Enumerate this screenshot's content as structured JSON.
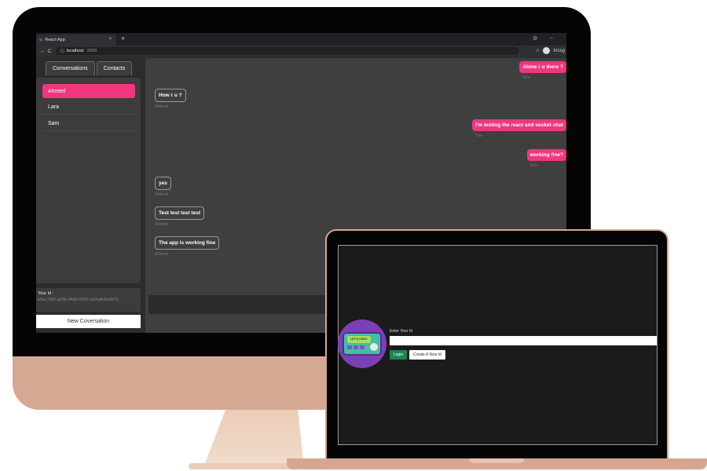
{
  "browser": {
    "tab_title": "React App",
    "tab_close": "×",
    "new_tab": "+",
    "url_host": "localhost",
    "url_port": ":3000",
    "profile_label": "Incog"
  },
  "sidebar": {
    "tabs": [
      {
        "label": "Conversations",
        "active": true
      },
      {
        "label": "Contacts",
        "active": false
      }
    ],
    "conversations": [
      {
        "name": "Ahmed",
        "active": true
      },
      {
        "name": "Lara",
        "active": false
      },
      {
        "name": "Sam",
        "active": false
      }
    ],
    "your_id_label": "Your Id :",
    "your_id_value": "e5ec7d2f-a05b-44d0-9002-e03a4c6e6b71",
    "new_conversation_label": "New Coversation"
  },
  "messages": [
    {
      "text": "Ahme r u there ?",
      "sender": "You",
      "outgoing": true
    },
    {
      "text": "How r u ?",
      "sender": "Ahmed",
      "outgoing": false
    },
    {
      "text": "I'm testing the react and socket chat",
      "sender": "You",
      "outgoing": true
    },
    {
      "text": "working fine?",
      "sender": "You",
      "outgoing": true
    },
    {
      "text": "yes",
      "sender": "Ahmed",
      "outgoing": false
    },
    {
      "text": "Test test test test",
      "sender": "Ahmed",
      "outgoing": false
    },
    {
      "text": "The app is working fine",
      "sender": "Ahmed",
      "outgoing": false
    }
  ],
  "login": {
    "label": "Enter Your Id",
    "input_value": "",
    "login_button": "Login",
    "create_button": "Create A New Id",
    "logo_text": "LET'S CHAT!"
  },
  "colors": {
    "accent": "#f0367f",
    "stand": "#d5a894",
    "login_green": "#198754",
    "logo_purple": "#7b3fb8"
  }
}
